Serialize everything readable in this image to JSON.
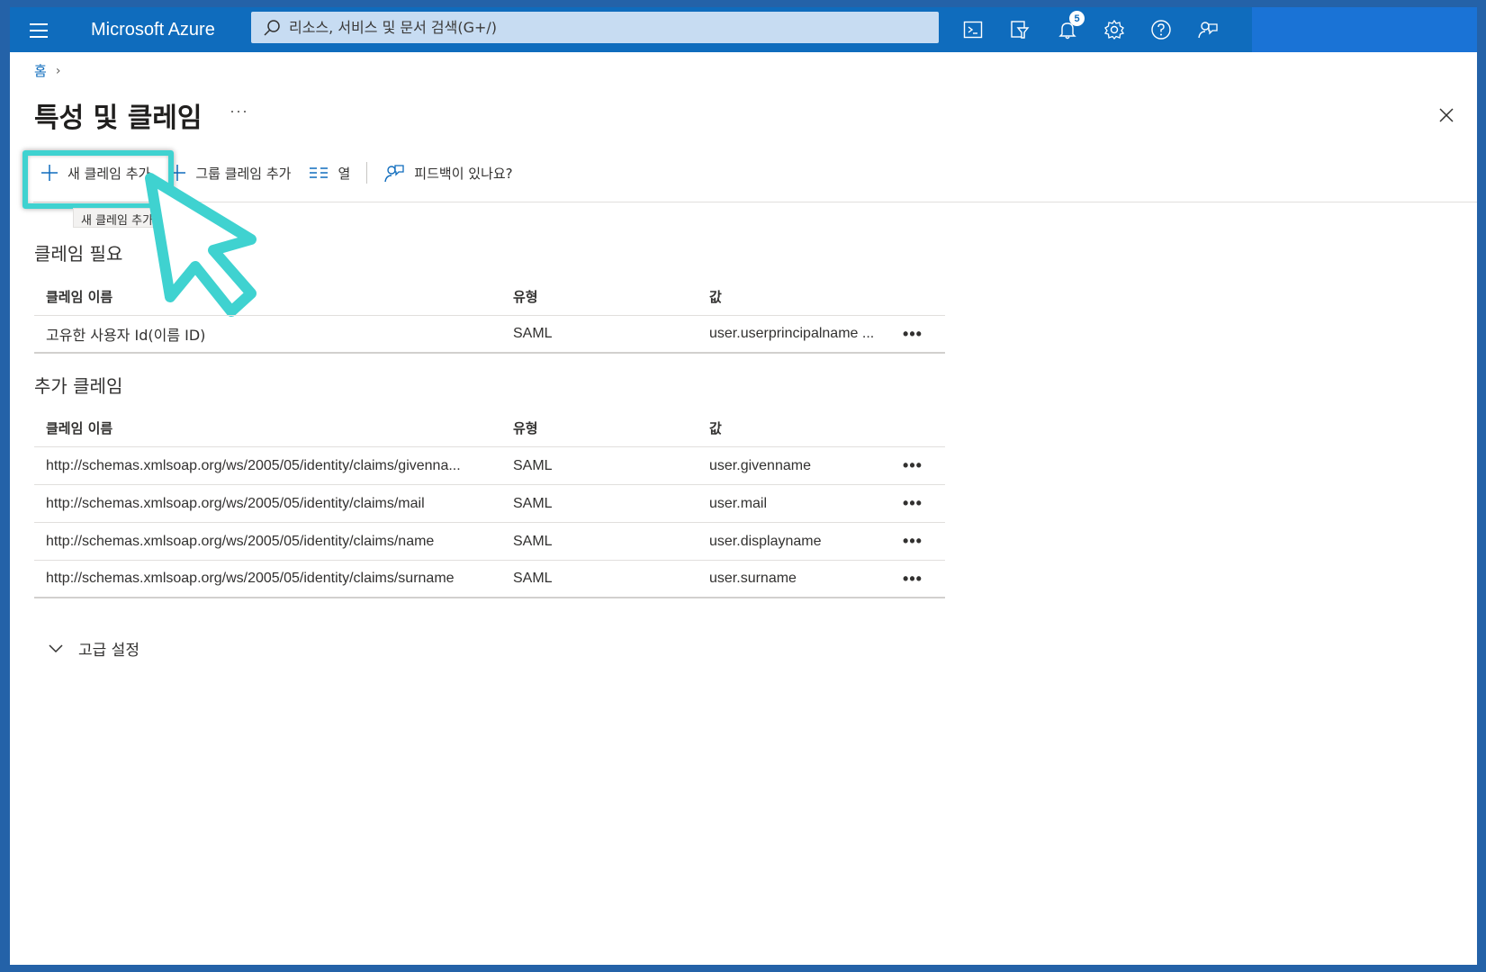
{
  "topbar": {
    "brand": "Microsoft Azure",
    "search_placeholder": "리소스, 서비스 및 문서 검색(G+/)",
    "notification_count": "5",
    "icons": [
      "cloud-shell-icon",
      "directory-filter-icon",
      "notifications-icon",
      "settings-icon",
      "help-icon",
      "feedback-icon"
    ]
  },
  "breadcrumb": {
    "home": "홈"
  },
  "page": {
    "title": "특성 및 클레임",
    "more": "···"
  },
  "commands": {
    "add_claim": "새 클레임 추가",
    "add_group_claim": "그룹 클레임 추가",
    "columns": "열",
    "feedback": "피드백이 있나요?",
    "tooltip": "새 클레임 추가"
  },
  "required_claims": {
    "title": "클레임 필요",
    "headers": {
      "name": "클레임 이름",
      "type": "유형",
      "value": "값"
    },
    "rows": [
      {
        "name": "고유한 사용자 Id(이름 ID)",
        "type": "SAML",
        "value": "user.userprincipalname ...",
        "more": "•••"
      }
    ]
  },
  "additional_claims": {
    "title": "추가 클레임",
    "headers": {
      "name": "클레임 이름",
      "type": "유형",
      "value": "값"
    },
    "rows": [
      {
        "name": "http://schemas.xmlsoap.org/ws/2005/05/identity/claims/givenna...",
        "type": "SAML",
        "value": "user.givenname",
        "more": "•••"
      },
      {
        "name": "http://schemas.xmlsoap.org/ws/2005/05/identity/claims/mail",
        "type": "SAML",
        "value": "user.mail",
        "more": "•••"
      },
      {
        "name": "http://schemas.xmlsoap.org/ws/2005/05/identity/claims/name",
        "type": "SAML",
        "value": "user.displayname",
        "more": "•••"
      },
      {
        "name": "http://schemas.xmlsoap.org/ws/2005/05/identity/claims/surname",
        "type": "SAML",
        "value": "user.surname",
        "more": "•••"
      }
    ]
  },
  "advanced": {
    "label": "고급 설정"
  },
  "colors": {
    "topbar": "#0f6cbd",
    "search_bg": "#c7dcf2",
    "highlight": "#3fd2d0",
    "link": "#0f6cbd"
  }
}
